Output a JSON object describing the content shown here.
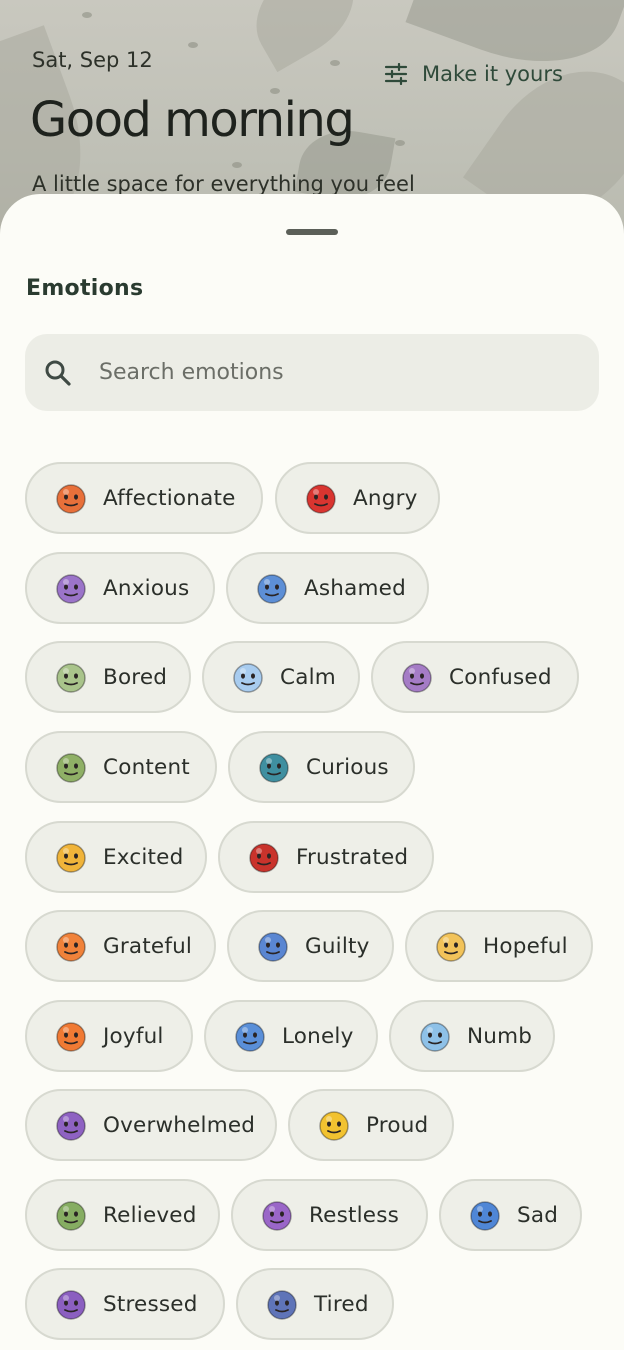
{
  "header": {
    "date": "Sat, Sep 12",
    "customize_label": "Make it yours",
    "customize_icon": "tune-sliders-icon",
    "greeting": "Good morning",
    "subtitle": "A little space for everything you feel"
  },
  "sheet": {
    "title": "Emotions",
    "search": {
      "placeholder": "Search emotions",
      "value": "",
      "icon": "search-icon"
    },
    "emotions": [
      {
        "label": "Affectionate",
        "icon": "affectionate-emoji-icon",
        "color": "#e8703a"
      },
      {
        "label": "Angry",
        "icon": "angry-emoji-icon",
        "color": "#d93530"
      },
      {
        "label": "Anxious",
        "icon": "anxious-emoji-icon",
        "color": "#9b74c9"
      },
      {
        "label": "Ashamed",
        "icon": "ashamed-emoji-icon",
        "color": "#5d8fd6"
      },
      {
        "label": "Bored",
        "icon": "bored-emoji-icon",
        "color": "#a9c48b"
      },
      {
        "label": "Calm",
        "icon": "calm-emoji-icon",
        "color": "#a8ccef"
      },
      {
        "label": "Confused",
        "icon": "confused-emoji-icon",
        "color": "#a57cc6"
      },
      {
        "label": "Content",
        "icon": "content-emoji-icon",
        "color": "#8fb066"
      },
      {
        "label": "Curious",
        "icon": "curious-emoji-icon",
        "color": "#3f8fa0"
      },
      {
        "label": "Excited",
        "icon": "excited-emoji-icon",
        "color": "#f0b43a"
      },
      {
        "label": "Frustrated",
        "icon": "frustrated-emoji-icon",
        "color": "#c9332c"
      },
      {
        "label": "Grateful",
        "icon": "grateful-emoji-icon",
        "color": "#f0823a"
      },
      {
        "label": "Guilty",
        "icon": "guilty-emoji-icon",
        "color": "#5a86d2"
      },
      {
        "label": "Hopeful",
        "icon": "hopeful-emoji-icon",
        "color": "#f2c35a"
      },
      {
        "label": "Joyful",
        "icon": "joyful-emoji-icon",
        "color": "#f07a34"
      },
      {
        "label": "Lonely",
        "icon": "lonely-emoji-icon",
        "color": "#5a8fd8"
      },
      {
        "label": "Numb",
        "icon": "numb-emoji-icon",
        "color": "#8ec1e8"
      },
      {
        "label": "Overwhelmed",
        "icon": "overwhelmed-emoji-icon",
        "color": "#8e62c2"
      },
      {
        "label": "Proud",
        "icon": "proud-emoji-icon",
        "color": "#f2c230"
      },
      {
        "label": "Relieved",
        "icon": "relieved-emoji-icon",
        "color": "#86ad62"
      },
      {
        "label": "Restless",
        "icon": "restless-emoji-icon",
        "color": "#9a66c8"
      },
      {
        "label": "Sad",
        "icon": "sad-emoji-icon",
        "color": "#4f86d6"
      },
      {
        "label": "Stressed",
        "icon": "stressed-emoji-icon",
        "color": "#8b5fc0"
      },
      {
        "label": "Tired",
        "icon": "tired-emoji-icon",
        "color": "#5f74b8"
      }
    ]
  },
  "colors": {
    "sheet_background": "#fcfcf7",
    "chip_background": "#eeefe8",
    "chip_border": "#d7d9d0",
    "accent": "#2f4a3a"
  }
}
